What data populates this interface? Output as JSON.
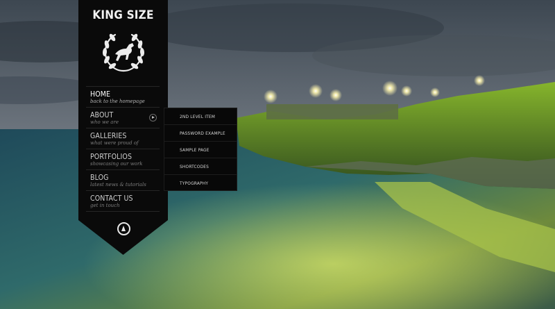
{
  "brand": {
    "title": "KING SIZE",
    "emblem": "laurel-wreath-horse-emblem"
  },
  "nav": {
    "items": [
      {
        "title": "HOME",
        "subtitle": "back to the homepage"
      },
      {
        "title": "ABOUT",
        "subtitle": "who we are"
      },
      {
        "title": "GALLERIES",
        "subtitle": "what were proud of"
      },
      {
        "title": "PORTFOLIOS",
        "subtitle": "showcasing our work"
      },
      {
        "title": "BLOG",
        "subtitle": "latest news & tutorials"
      },
      {
        "title": "CONTACT US",
        "subtitle": "get in touch"
      }
    ],
    "active_index": 0
  },
  "submenu": {
    "items": [
      {
        "label": "2ND LEVEL ITEM"
      },
      {
        "label": "PASSWORD EXAMPLE"
      },
      {
        "label": "SAMPLE PAGE"
      },
      {
        "label": "SHORTCODES"
      },
      {
        "label": "TYPOGRAPHY"
      }
    ]
  },
  "icons": {
    "submenu_arrow": "play-arrow-icon",
    "scroll_up": "up-arrow-icon"
  },
  "colors": {
    "sidebar": "#0a0a0a",
    "text": "#cfcfcf",
    "accent_grass": "#8fbf2a",
    "sky": "#5a6b7a"
  }
}
